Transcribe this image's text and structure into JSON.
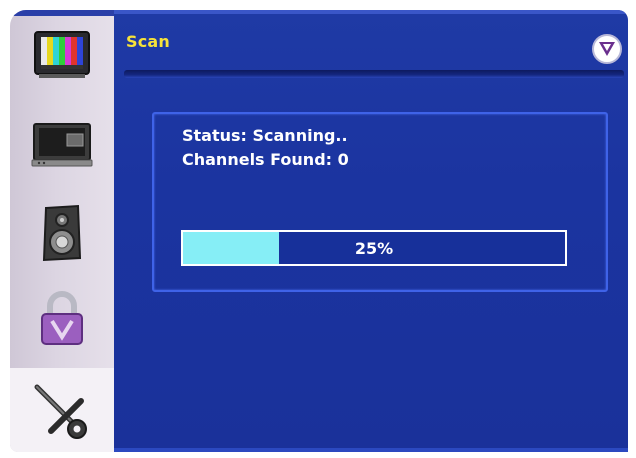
{
  "header": {
    "title": "Scan",
    "logo_icon": "vizio-v-logo-icon"
  },
  "sidebar": {
    "items": [
      {
        "icon": "picture-icon",
        "selected": false
      },
      {
        "icon": "tv-screen-icon",
        "selected": false
      },
      {
        "icon": "speaker-icon",
        "selected": false
      },
      {
        "icon": "lock-icon",
        "selected": false
      },
      {
        "icon": "wrench-icon",
        "selected": true
      }
    ]
  },
  "scan": {
    "status_text": "Status: Scanning..",
    "channels_text": "Channels Found: 0",
    "progress_label": "25%",
    "progress_fraction": 0.25
  },
  "colors": {
    "panel_blue": "#1d37a2",
    "title_yellow": "#f6e23a",
    "progress_fill": "#86eef6",
    "sidebar_lavender": "#dcd5e2"
  }
}
